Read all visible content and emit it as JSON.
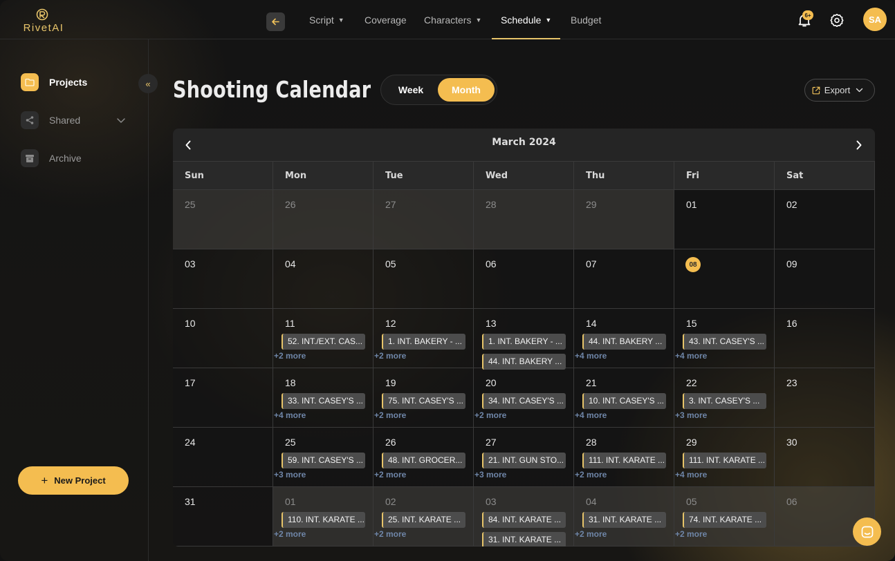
{
  "app": {
    "logo_text": "RivetAI"
  },
  "nav": {
    "items": [
      {
        "label": "Script",
        "dropdown": true,
        "active": false
      },
      {
        "label": "Coverage",
        "dropdown": false,
        "active": false
      },
      {
        "label": "Characters",
        "dropdown": true,
        "active": false
      },
      {
        "label": "Schedule",
        "dropdown": true,
        "active": true
      },
      {
        "label": "Budget",
        "dropdown": false,
        "active": false
      }
    ]
  },
  "header": {
    "notification_badge": "6+",
    "avatar_initials": "SA"
  },
  "sidebar": {
    "items": [
      {
        "label": "Projects",
        "icon": "folder-icon",
        "active": true
      },
      {
        "label": "Shared",
        "icon": "share-icon",
        "active": false,
        "dropdown": true
      },
      {
        "label": "Archive",
        "icon": "archive-icon",
        "active": false
      }
    ],
    "collapse_glyph": "«",
    "new_project_label": "New Project"
  },
  "page": {
    "title": "Shooting Calendar",
    "view_toggle": {
      "week_label": "Week",
      "month_label": "Month",
      "selected": "Month"
    },
    "export_label": "Export"
  },
  "calendar": {
    "month_label": "March 2024",
    "weekdays": [
      "Sun",
      "Mon",
      "Tue",
      "Wed",
      "Thu",
      "Fri",
      "Sat"
    ],
    "today": "08",
    "weeks": [
      [
        {
          "day": "25",
          "other": true,
          "events": [],
          "more": ""
        },
        {
          "day": "26",
          "other": true,
          "events": [],
          "more": ""
        },
        {
          "day": "27",
          "other": true,
          "events": [],
          "more": ""
        },
        {
          "day": "28",
          "other": true,
          "events": [],
          "more": ""
        },
        {
          "day": "29",
          "other": true,
          "events": [],
          "more": ""
        },
        {
          "day": "01",
          "other": false,
          "events": [],
          "more": ""
        },
        {
          "day": "02",
          "other": false,
          "events": [],
          "more": ""
        }
      ],
      [
        {
          "day": "03",
          "other": false,
          "events": [],
          "more": ""
        },
        {
          "day": "04",
          "other": false,
          "events": [],
          "more": ""
        },
        {
          "day": "05",
          "other": false,
          "events": [],
          "more": ""
        },
        {
          "day": "06",
          "other": false,
          "events": [],
          "more": ""
        },
        {
          "day": "07",
          "other": false,
          "events": [],
          "more": ""
        },
        {
          "day": "08",
          "other": false,
          "today": true,
          "events": [],
          "more": ""
        },
        {
          "day": "09",
          "other": false,
          "events": [],
          "more": ""
        }
      ],
      [
        {
          "day": "10",
          "other": false,
          "events": [],
          "more": ""
        },
        {
          "day": "11",
          "other": false,
          "events": [
            "52. INT./EXT. CAS..."
          ],
          "more": "+2 more"
        },
        {
          "day": "12",
          "other": false,
          "events": [
            "1. INT. BAKERY - ..."
          ],
          "more": "+2 more"
        },
        {
          "day": "13",
          "other": false,
          "events": [
            "1. INT. BAKERY - ...",
            "44. INT. BAKERY ..."
          ],
          "more": ""
        },
        {
          "day": "14",
          "other": false,
          "events": [
            "44. INT. BAKERY ..."
          ],
          "more": "+4 more"
        },
        {
          "day": "15",
          "other": false,
          "events": [
            "43. INT. CASEY'S ..."
          ],
          "more": "+4 more"
        },
        {
          "day": "16",
          "other": false,
          "events": [],
          "more": ""
        }
      ],
      [
        {
          "day": "17",
          "other": false,
          "events": [],
          "more": ""
        },
        {
          "day": "18",
          "other": false,
          "events": [
            "33. INT. CASEY'S ..."
          ],
          "more": "+4 more"
        },
        {
          "day": "19",
          "other": false,
          "events": [
            "75. INT. CASEY'S ..."
          ],
          "more": "+2 more"
        },
        {
          "day": "20",
          "other": false,
          "events": [
            "34. INT. CASEY'S ..."
          ],
          "more": "+2 more"
        },
        {
          "day": "21",
          "other": false,
          "events": [
            "10. INT. CASEY'S ..."
          ],
          "more": "+4 more"
        },
        {
          "day": "22",
          "other": false,
          "events": [
            "3. INT. CASEY'S ..."
          ],
          "more": "+3 more"
        },
        {
          "day": "23",
          "other": false,
          "events": [],
          "more": ""
        }
      ],
      [
        {
          "day": "24",
          "other": false,
          "events": [],
          "more": ""
        },
        {
          "day": "25",
          "other": false,
          "events": [
            "59. INT. CASEY'S ..."
          ],
          "more": "+3 more"
        },
        {
          "day": "26",
          "other": false,
          "events": [
            "48. INT. GROCER..."
          ],
          "more": "+2 more"
        },
        {
          "day": "27",
          "other": false,
          "events": [
            "21. INT. GUN STO..."
          ],
          "more": "+3 more"
        },
        {
          "day": "28",
          "other": false,
          "events": [
            "111. INT. KARATE ..."
          ],
          "more": "+2 more"
        },
        {
          "day": "29",
          "other": false,
          "events": [
            "111. INT. KARATE ..."
          ],
          "more": "+4 more"
        },
        {
          "day": "30",
          "other": false,
          "events": [],
          "more": ""
        }
      ],
      [
        {
          "day": "31",
          "other": false,
          "events": [],
          "more": ""
        },
        {
          "day": "01",
          "other": true,
          "events": [
            "110. INT. KARATE ..."
          ],
          "more": "+2 more"
        },
        {
          "day": "02",
          "other": true,
          "events": [
            "25. INT. KARATE ..."
          ],
          "more": "+2 more"
        },
        {
          "day": "03",
          "other": true,
          "events": [
            "84. INT. KARATE ...",
            "31. INT. KARATE ..."
          ],
          "more": ""
        },
        {
          "day": "04",
          "other": true,
          "events": [
            "31. INT. KARATE ..."
          ],
          "more": "+2 more"
        },
        {
          "day": "05",
          "other": true,
          "events": [
            "74. INT. KARATE ..."
          ],
          "more": "+2 more"
        },
        {
          "day": "06",
          "other": true,
          "events": [],
          "more": ""
        }
      ]
    ]
  },
  "colors": {
    "accent": "#f4bd50",
    "more_link": "#6f86a8",
    "background": "#141414"
  }
}
